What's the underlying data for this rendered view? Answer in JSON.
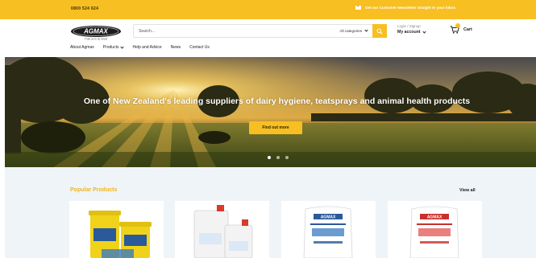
{
  "topbar": {
    "phone": "0800 524 624",
    "newsletter": "Get our Customer Newsletter straight to your inbox",
    "icon": "mail-icon"
  },
  "header": {
    "logo_text": "AGMAX",
    "logo_tagline": "Trust us to do Great",
    "search": {
      "placeholder": "Search...",
      "category_label": "All categories",
      "icon": "search-icon"
    },
    "account": {
      "line1": "Login / Signup",
      "line2": "My account"
    },
    "cart": {
      "label": "Cart",
      "icon": "cart-icon"
    }
  },
  "nav": {
    "items": [
      {
        "label": "About Agmax"
      },
      {
        "label": "Products"
      },
      {
        "label": "Help and Advice"
      },
      {
        "label": "News"
      },
      {
        "label": "Contact Us"
      }
    ]
  },
  "hero": {
    "headline": "One of New Zealand's leading suppliers of dairy hygiene, teatsprays and animal health products",
    "cta_label": "Find out more",
    "slides": 3,
    "active_slide": 1
  },
  "popular": {
    "title": "Popular Products",
    "view_all": "View all"
  },
  "colors": {
    "brand_yellow": "#f7bf22",
    "section_bg": "#eef4f7",
    "title_orange": "#f2b51c"
  }
}
